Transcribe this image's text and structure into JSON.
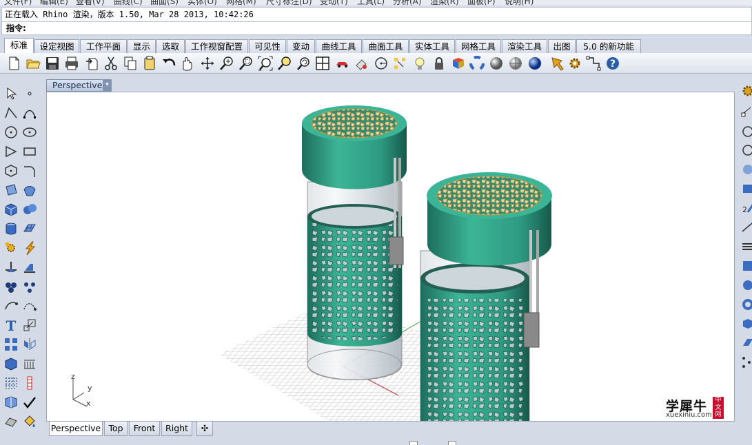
{
  "menu": [
    "文件(F)",
    "编辑(E)",
    "查看(V)",
    "曲线(C)",
    "曲面(S)",
    "实体(O)",
    "网格(M)",
    "尺寸标注(D)",
    "变动(T)",
    "工具(L)",
    "分析(A)",
    "渲染(R)",
    "面板(P)",
    "说明(H)"
  ],
  "command": {
    "history": "正在载入 Rhino 渲染，版本 1.50, Mar 28 2013, 10:42:26",
    "prompt": "指令:"
  },
  "tabs": [
    "标准",
    "设定视图",
    "工作平面",
    "显示",
    "选取",
    "工作视窗配置",
    "可见性",
    "变动",
    "曲线工具",
    "曲面工具",
    "实体工具",
    "网格工具",
    "渲染工具",
    "出图",
    "5.0 的新功能"
  ],
  "active_tab": "标准",
  "toolbar_icons": [
    "new-file-icon",
    "open-folder-icon",
    "save-icon",
    "print-icon",
    "import-icon",
    "cut-icon",
    "copy-icon",
    "paste-icon",
    "undo-icon",
    "pan-hand-icon",
    "rotate-view-icon",
    "zoom-dynamic-icon",
    "zoom-window-icon",
    "zoom-extents-icon",
    "zoom-selected-icon",
    "rotate-camera-icon",
    "four-viewports-icon",
    "car-icon",
    "object-snap-icon",
    "circle-icon",
    "select-points-icon",
    "light-bulb-icon",
    "lock-icon",
    "render-color-icon",
    "color-wheel-icon",
    "material-sphere-icon",
    "environment-sphere-icon",
    "blue-sphere-icon",
    "properties-icon",
    "settings-gear-icon",
    "grid-snap-icon",
    "help-icon"
  ],
  "viewport": {
    "name": "Perspective",
    "dropdown": "▾",
    "axes": {
      "x": "x",
      "y": "y",
      "z": "z"
    }
  },
  "watermark": {
    "brand": "学犀牛",
    "site": "xuexiniu.com",
    "badge": "中文网"
  },
  "view_tabs": [
    "Perspective",
    "Top",
    "Front",
    "Right"
  ],
  "add_tab": "✣",
  "colors": {
    "teal": "#2e9a82",
    "teal_dark": "#1d6e5d",
    "gold": "#d8bf7a",
    "accent_blue": "#2a5ea8"
  }
}
